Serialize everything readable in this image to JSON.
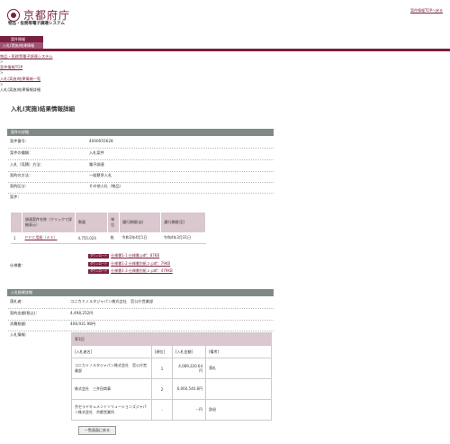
{
  "header": {
    "logo_text": "京都府庁",
    "system_name": "物品・役務等電子調達システム",
    "top_link": "案件情報TOPへ戻る"
  },
  "menu": {
    "item1": "案件情報",
    "item2": "入札(実施)結果情報"
  },
  "breadcrumb": {
    "items": [
      "物品・役務等電子調達システム",
      "案件情報TOP",
      "入札(実施)結果情報一覧",
      "入札(実施)結果情報詳細"
    ],
    "separator": ">"
  },
  "page_title": "入札(実施)結果情報詳細",
  "case_section": {
    "header": "案件の詳細",
    "rows": [
      {
        "label": "案件番号：",
        "value": "4000055628"
      },
      {
        "label": "案件の種類：",
        "value": "入札案件"
      },
      {
        "label": "入札（見積）方法：",
        "value": "電子調達"
      },
      {
        "label": "契約の方法：",
        "value": "一般競争入札"
      },
      {
        "label": "契約区分：",
        "value": "その他入札（物品）"
      },
      {
        "label": "案件：",
        "value": ""
      }
    ]
  },
  "items_table": {
    "headers": [
      "",
      "調達案件名称（クリックで詳細表示）",
      "数量",
      "単位",
      "履行期間(自)",
      "履行期間(至)"
    ],
    "rows": [
      [
        "1",
        "ＰＰＣ用紙（Ａ４）",
        "4,755,024",
        "枚",
        "令和3年4月1日",
        "令和4年3月31日"
      ]
    ]
  },
  "spec": {
    "label": "仕様書：",
    "badge": "ダウンロード",
    "files": [
      "仕様書1-1 仕様書.pdf：87KB",
      "仕様書1-2 仕様書別紙２.pdf：79KB",
      "仕様書1-3 仕様書別紙２.pdf：479KB"
    ]
  },
  "result_section": {
    "header": "入札結果詳細",
    "rows": [
      {
        "label": "落札者：",
        "value": "コニカミノルタジャパン株式会社　官公庁営業部"
      },
      {
        "label": "契約金額(税込)：",
        "value": "4,498,252円"
      },
      {
        "label": "消費税額：",
        "value": "408,931.98円"
      },
      {
        "label": "入札情報：",
        "value": ""
      }
    ]
  },
  "bids_table": {
    "round": "第1回",
    "headers": [
      "[入札者名]",
      "[順位]",
      "[入札金額]",
      "[備考]"
    ],
    "rows": [
      [
        "コニカミノルタジャパン株式会社　官公庁営業部",
        "1",
        "4,089,320.64円",
        "落札"
      ],
      [
        "株式会社　三井田商事",
        "2",
        "6,060,540.8円",
        ""
      ],
      [
        "京セラドキュメントソリューションズジャパン株式会社　京都営業所",
        "-",
        "－円",
        "辞退"
      ]
    ]
  },
  "back_button": "一覧画面に戻る"
}
